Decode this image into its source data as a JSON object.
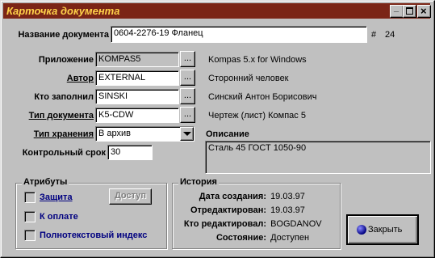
{
  "window": {
    "title": "Карточка документа",
    "minimize_glyph": "_",
    "maximize_glyph": "□",
    "close_glyph": "×"
  },
  "doc_name": {
    "label": "Название документа",
    "value": "0604-2276-19  Фланец",
    "hash": "#",
    "number": "24"
  },
  "app": {
    "label": "Приложение",
    "value": "KOMPAS5",
    "desc": "Kompas 5.x for Windows"
  },
  "author": {
    "label": "Автор",
    "value": "EXTERNAL",
    "desc": "Сторонний человек"
  },
  "filled_by": {
    "label": "Кто заполнил",
    "value": "SINSKI",
    "desc": "Синский Антон Борисович"
  },
  "doc_type": {
    "label": "Тип документа",
    "value": "K5-CDW",
    "desc": "Чертеж (лист) Компас 5"
  },
  "storage": {
    "label": "Тип хранения",
    "value": "В архив"
  },
  "control": {
    "label": "Контрольный срок",
    "value": "30"
  },
  "description": {
    "label": "Описание",
    "value": "Сталь 45 ГОСТ 1050-90"
  },
  "attributes": {
    "title": "Атрибуты",
    "protection": "Защита",
    "access_button": "Доступ",
    "payment": "К оплате",
    "fulltext": "Полнотекстовый индекс"
  },
  "history": {
    "title": "История",
    "created_label": "Дата создания:",
    "created_value": "19.03.97",
    "edited_label": "Отредактирован:",
    "edited_value": "19.03.97",
    "editor_label": "Кто редактировал:",
    "editor_value": "BOGDANOV",
    "state_label": "Состояние:",
    "state_value": "Доступен"
  },
  "close_button": "Закрыть",
  "ellipsis": "...",
  "colors": {
    "titlebar": "#7b2516",
    "title_text": "#ffd24a",
    "face": "#c0c0c0",
    "link_text": "#000080"
  }
}
